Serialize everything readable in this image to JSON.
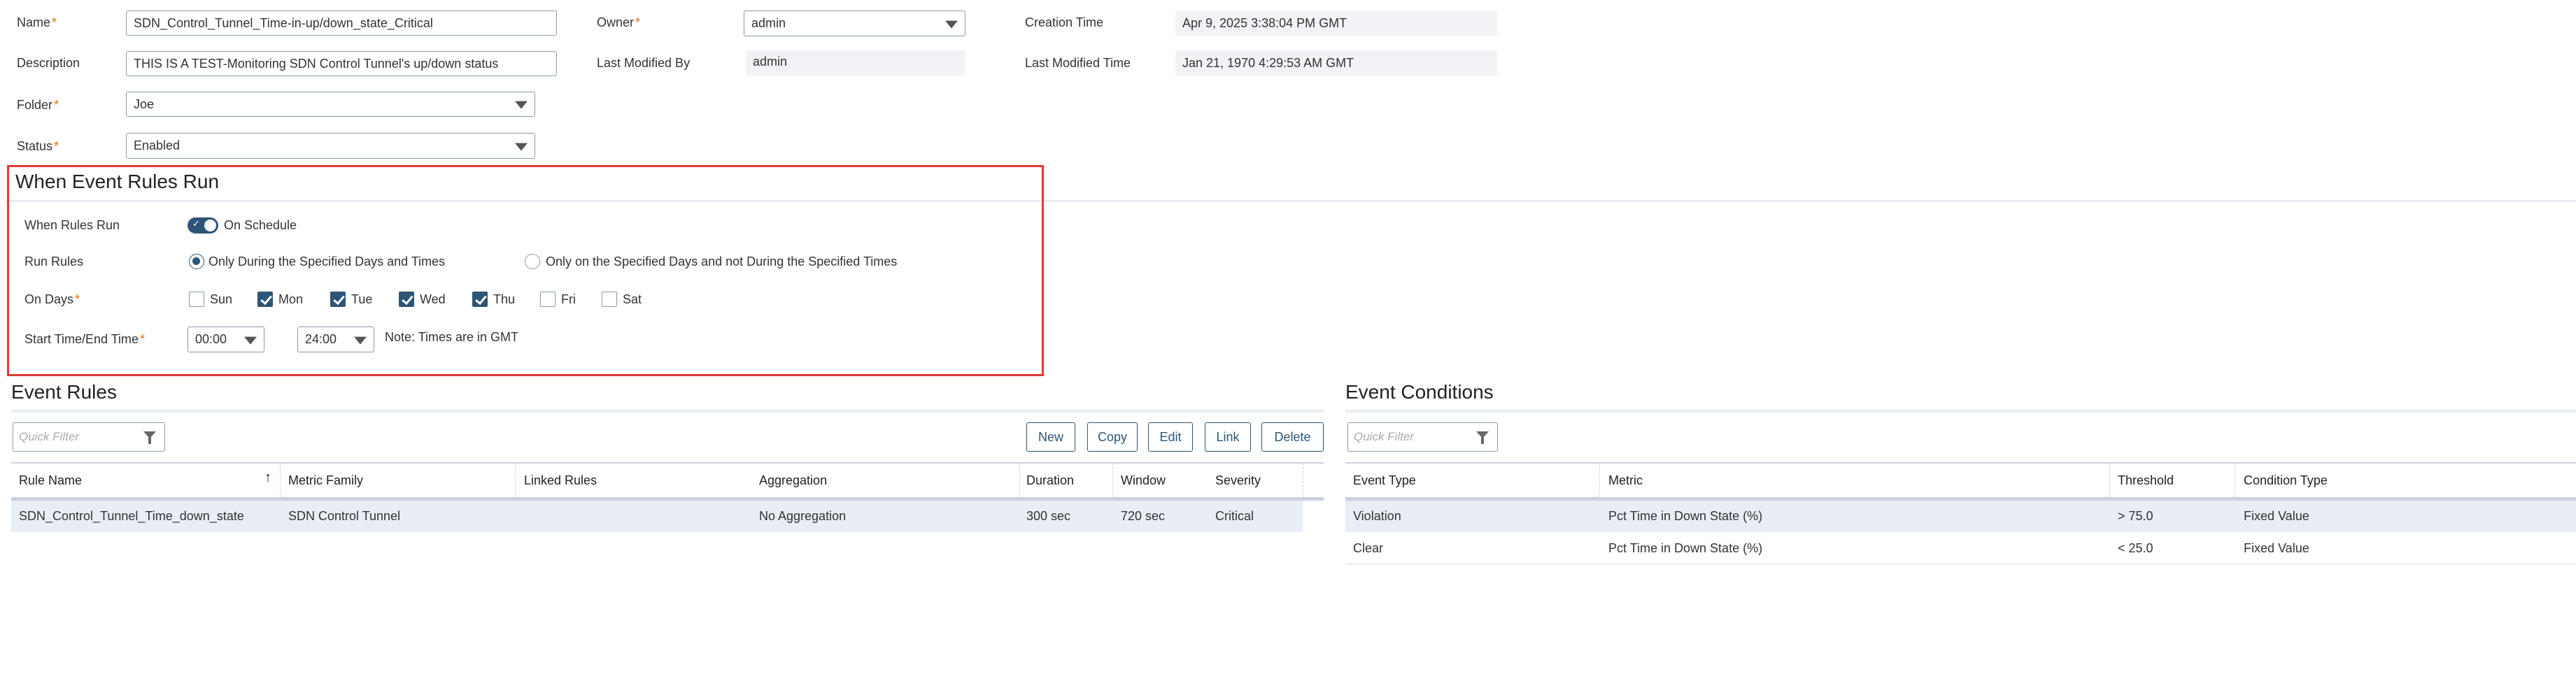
{
  "form": {
    "name_label": "Name",
    "name_value": "SDN_Control_Tunnel_Time-in-up/down_state_Critical",
    "description_label": "Description",
    "description_value": "THIS IS A TEST-Monitoring SDN Control Tunnel's up/down status",
    "folder_label": "Folder",
    "folder_value": "Joe",
    "status_label": "Status",
    "status_value": "Enabled",
    "owner_label": "Owner",
    "owner_value": "admin",
    "last_modified_by_label": "Last Modified By",
    "last_modified_by_value": "admin",
    "creation_time_label": "Creation Time",
    "creation_time_value": "Apr 9, 2025 3:38:04 PM GMT",
    "last_modified_time_label": "Last Modified Time",
    "last_modified_time_value": "Jan 21, 1970 4:29:53 AM GMT",
    "required_mark": "*"
  },
  "schedule": {
    "title": "When Event Rules Run",
    "when_label": "When Rules Run",
    "toggle_label": "On Schedule",
    "toggle_on": true,
    "run_rules_label": "Run Rules",
    "radio_options": [
      {
        "label": "Only During the Specified Days and Times",
        "selected": true
      },
      {
        "label": "Only on the Specified Days and not During the Specified Times",
        "selected": false
      }
    ],
    "days_label": "On Days",
    "days": [
      {
        "label": "Sun",
        "checked": false
      },
      {
        "label": "Mon",
        "checked": true
      },
      {
        "label": "Tue",
        "checked": true
      },
      {
        "label": "Wed",
        "checked": true
      },
      {
        "label": "Thu",
        "checked": true
      },
      {
        "label": "Fri",
        "checked": false
      },
      {
        "label": "Sat",
        "checked": false
      }
    ],
    "time_label": "Start Time/End Time",
    "start_time": "00:00",
    "end_time": "24:00",
    "note": "Note: Times are in GMT"
  },
  "event_rules": {
    "title": "Event Rules",
    "filter_placeholder": "Quick Filter",
    "buttons": [
      "New",
      "Copy",
      "Edit",
      "Link",
      "Delete"
    ],
    "columns": [
      "Rule Name",
      "Metric Family",
      "Linked Rules",
      "Aggregation",
      "Duration",
      "Window",
      "Severity"
    ],
    "rows": [
      [
        "SDN_Control_Tunnel_Time_down_state",
        "SDN Control Tunnel",
        "",
        "No Aggregation",
        "300 sec",
        "720 sec",
        "Critical"
      ]
    ]
  },
  "event_conditions": {
    "title": "Event Conditions",
    "filter_placeholder": "Quick Filter",
    "columns": [
      "Event Type",
      "Metric",
      "Threshold",
      "Condition Type"
    ],
    "rows": [
      [
        "Violation",
        "Pct Time in Down State (%)",
        "> 75.0",
        "Fixed Value"
      ],
      [
        "Clear",
        "Pct Time in Down State (%)",
        "< 25.0",
        "Fixed Value"
      ]
    ]
  },
  "colors": {
    "accent": "#2d5577",
    "highlight_border": "#e53935",
    "row_highlight": "#e9edf5"
  }
}
